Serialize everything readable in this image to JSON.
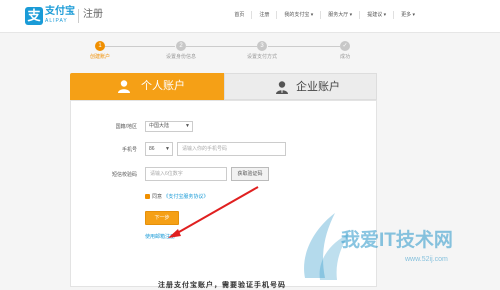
{
  "header": {
    "logo_mark": "支",
    "logo_name": "支付宝",
    "logo_sub": "ALIPAY",
    "page_name": "注册",
    "nav": [
      "首页",
      "注册",
      "我的支付宝 ▾",
      "服务大厅 ▾",
      "提建议 ▾",
      "更多 ▾"
    ]
  },
  "steps": [
    {
      "num": "1",
      "label": "创建账户",
      "active": true
    },
    {
      "num": "2",
      "label": "设置身份信息",
      "active": false
    },
    {
      "num": "3",
      "label": "设置支付方式",
      "active": false
    },
    {
      "num": "✓",
      "label": "成功",
      "active": false
    }
  ],
  "tabs": {
    "personal": "个人账户",
    "business": "企业账户"
  },
  "form": {
    "region_label": "国籍/地区",
    "region_value": "中国大陆",
    "mobile_label": "手机号",
    "mobile_prefix": "86",
    "mobile_placeholder": "请输入你的手机号码",
    "code_label": "短信校验码",
    "code_placeholder": "请输入6位数字",
    "get_code": "获取验证码",
    "agree_text": "同意",
    "agree_link": "《支付宝服务协议》",
    "next": "下一步",
    "email_link": "使用邮箱注册"
  },
  "bottom_text": "注册支付宝账户，需要验证手机号码",
  "watermark": {
    "cn": "我爱IT技术网",
    "url": "www.52ij.com"
  },
  "colors": {
    "accent": "#f5a016",
    "brand": "#1a9bd7",
    "annotation": "#e02020"
  }
}
